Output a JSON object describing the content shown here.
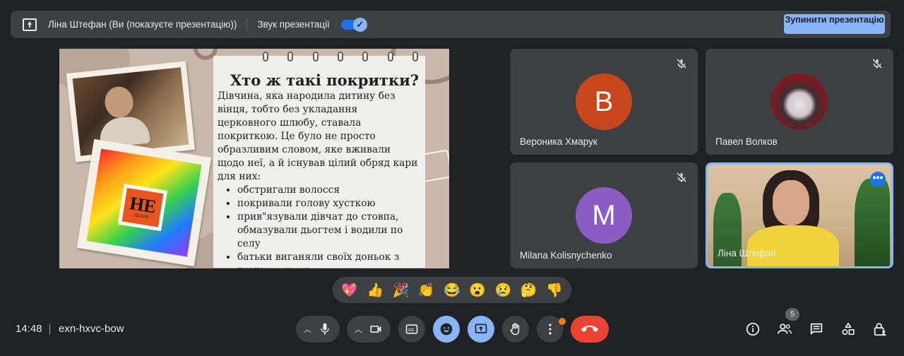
{
  "topbar": {
    "presenter_text": "Ліна Штефан (Ви (показуєте презентацію))",
    "sound_label": "Звук презентації",
    "sound_enabled": true,
    "stop_button": "Зупинити презентацію"
  },
  "slide": {
    "title": "Хто ж такі покритки?",
    "paragraph": "Дівчина, яка народила дитину без вінця, тобто без укладання церковного шлюбу, ставала покриткою. Це було не просто образливим словом, яке вживали щодо неї, а й існував цілий обряд кари для них:",
    "bullets": [
      "обстригали волосся",
      "покривали голову хусткою",
      "прив\"язували дівчат до стовпа, обмазували дьогтем і водили по селу",
      "батьки виганяли своїх доньок з дому"
    ],
    "sign_big": "НЕ",
    "sign_small": "ЦЬКУЙ"
  },
  "participants": [
    {
      "name": "Вероника Хмарук",
      "initial": "B",
      "avatar_color": "#c8451d",
      "muted": true
    },
    {
      "name": "Павел Волков",
      "initial": "",
      "avatar_color": "#7a1a22",
      "muted": true
    },
    {
      "name": "Milana Kolisnychenko",
      "initial": "M",
      "avatar_color": "#8b5cc4",
      "muted": true
    },
    {
      "name": "Ліна Штефан",
      "initial": "",
      "avatar_color": "",
      "muted": false
    }
  ],
  "reactions": [
    "💖",
    "👍",
    "🎉",
    "👏",
    "😂",
    "😮",
    "😢",
    "🤔",
    "👎"
  ],
  "bottom": {
    "time": "14:48",
    "meeting_code": "exn-hxvc-bow",
    "people_count": "5"
  },
  "colors": {
    "background": "#202124",
    "surface": "#3c4043",
    "accent": "#8ab4f8",
    "end_call": "#ea4335"
  }
}
